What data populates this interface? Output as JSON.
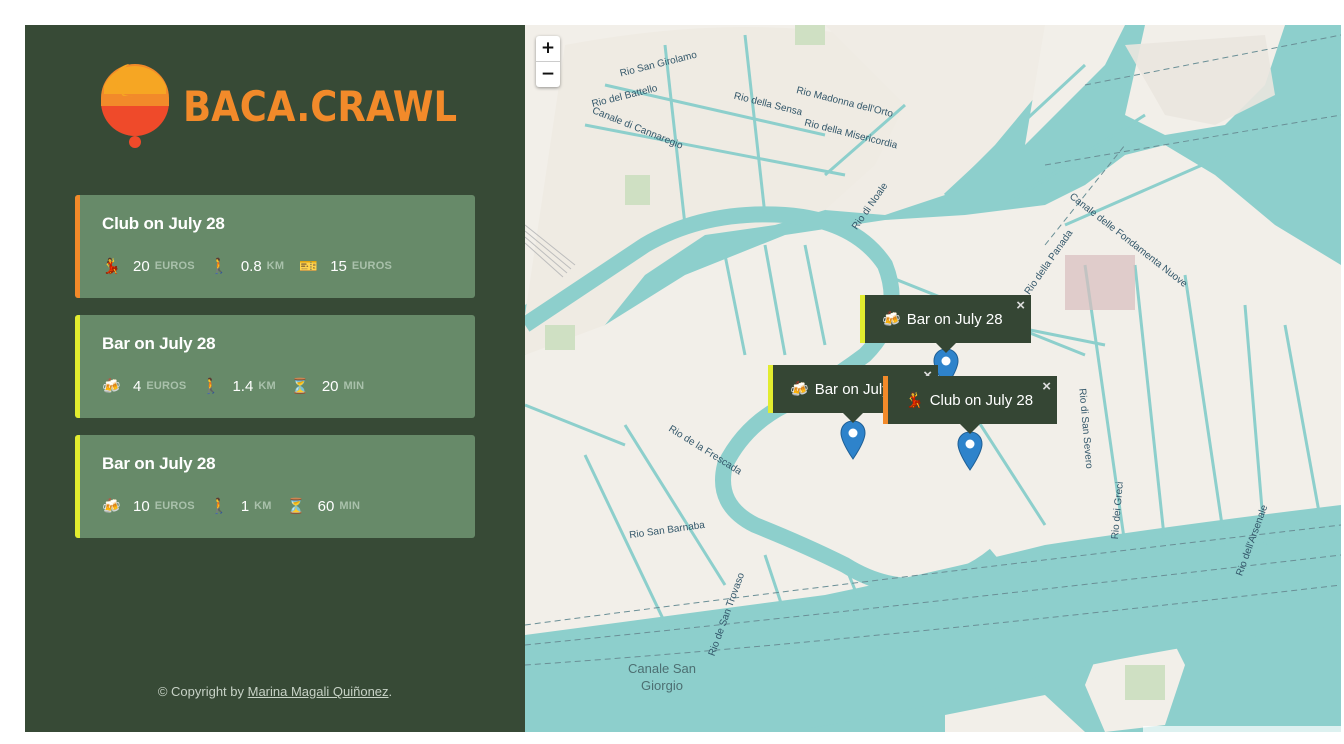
{
  "brand": {
    "name": "BACA.CRAWL"
  },
  "cards": [
    {
      "title": "Club on July 28",
      "accent": "#f28a2a",
      "type_icon": "dancer-icon",
      "stats": [
        {
          "icon": "dancer-icon",
          "emoji": "💃",
          "value": "20",
          "unit": "EUROS"
        },
        {
          "icon": "walking-icon",
          "emoji": "🚶",
          "value": "0.8",
          "unit": "KM"
        },
        {
          "icon": "ticket-icon",
          "emoji": "🎫",
          "value": "15",
          "unit": "EUROS"
        }
      ]
    },
    {
      "title": "Bar on July 28",
      "accent": "#e2ec2f",
      "type_icon": "beer-icon",
      "stats": [
        {
          "icon": "beer-icon",
          "emoji": "🍻",
          "value": "4",
          "unit": "EUROS"
        },
        {
          "icon": "walking-icon",
          "emoji": "🚶",
          "value": "1.4",
          "unit": "KM"
        },
        {
          "icon": "hourglass-icon",
          "emoji": "⏳",
          "value": "20",
          "unit": "MIN"
        }
      ]
    },
    {
      "title": "Bar on July 28",
      "accent": "#e2ec2f",
      "type_icon": "beer-icon",
      "stats": [
        {
          "icon": "beer-icon",
          "emoji": "🍻",
          "value": "10",
          "unit": "EUROS"
        },
        {
          "icon": "walking-icon",
          "emoji": "🚶",
          "value": "1",
          "unit": "KM"
        },
        {
          "icon": "hourglass-icon",
          "emoji": "⏳",
          "value": "60",
          "unit": "MIN"
        }
      ]
    }
  ],
  "footer": {
    "prefix": "© Copyright by ",
    "author": "Marina Magali Quiñonez",
    "suffix": "."
  },
  "map": {
    "zoom_in": "+",
    "zoom_out": "−",
    "close_symbol": "×",
    "popups": [
      {
        "label": "Bar on July 28",
        "emoji": "🍻",
        "accent": "#e2ec2f"
      },
      {
        "label": "Bar on July 28",
        "emoji": "🍻",
        "accent": "#e2ec2f"
      },
      {
        "label": "Club on July 28",
        "emoji": "💃",
        "accent": "#f28a2a"
      }
    ],
    "labels": {
      "canale_san_giorgio": "Canale San Giorgio",
      "rio_san_girolamo": "Rio San Girolamo",
      "rio_del_battello": "Rio del Battello",
      "rio_della_sensa": "Rio della Sensa",
      "rio_madonna_dell_orto": "Rio Madonna dell'Orto",
      "rio_della_misericordia": "Rio della Misericordia",
      "rio_di_noale": "Rio di Noale",
      "rio_della_panada": "Rio della Panada",
      "rio_di_san_severo": "Rio di San Severo",
      "rio_san_barnaba": "Rio San Barnaba",
      "rio_de_la_frescada": "Rio de la Frescada",
      "rio_de_san_trovaso": "Rio de San Trovaso",
      "rio_del_greci": "Rio dei Greci",
      "rio_dell_arsenale": "Rio dell'Arsenale",
      "canale_di_cannaregio": "Canale di Cannaregio",
      "fondamenta_nuove": "Canale delle Fondamenta Nuove"
    },
    "water": "#8dcfcc",
    "land": "#f2efe9"
  }
}
